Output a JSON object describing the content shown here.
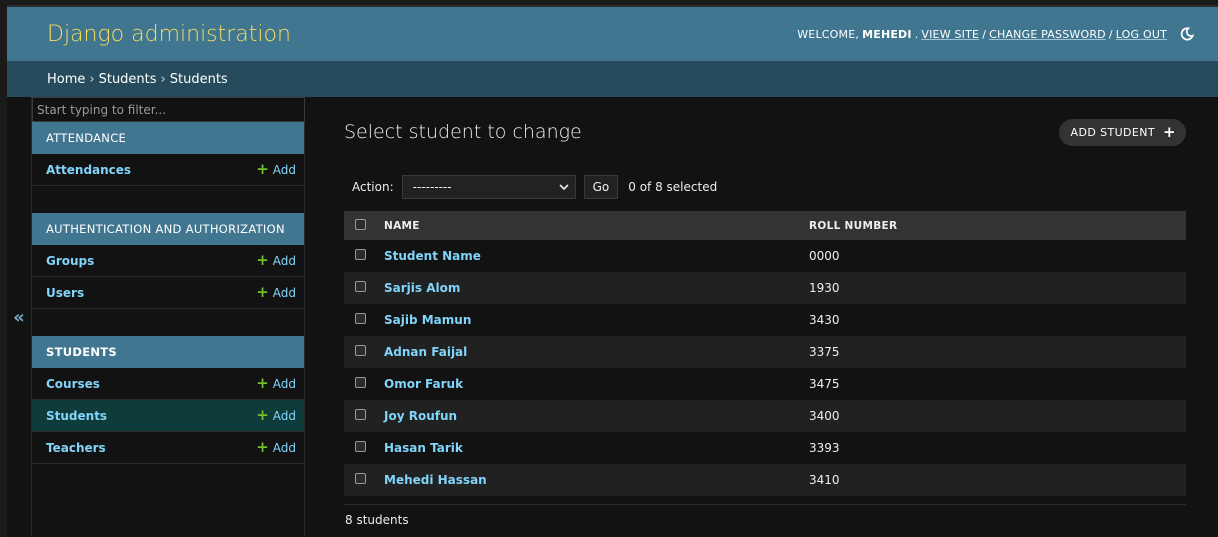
{
  "header": {
    "brand": "Django administration",
    "welcome": "WELCOME,",
    "username": "MEHEDI",
    "view_site": "VIEW SITE",
    "change_password": "CHANGE PASSWORD",
    "log_out": "LOG OUT",
    "separator": "/"
  },
  "breadcrumbs": [
    "Home",
    "Students",
    "Students"
  ],
  "nav_toggle": "«",
  "sidebar": {
    "filter_placeholder": "Start typing to filter...",
    "add_label": "Add",
    "modules": [
      {
        "caption": "ATTENDANCE",
        "models": [
          "Attendances"
        ]
      },
      {
        "caption": "AUTHENTICATION AND AUTHORIZATION",
        "models": [
          "Groups",
          "Users"
        ]
      },
      {
        "caption": "STUDENTS",
        "models": [
          "Courses",
          "Students",
          "Teachers"
        ],
        "current": "Students"
      }
    ]
  },
  "content": {
    "title": "Select student to change",
    "add_button": "ADD STUDENT",
    "action_label": "Action:",
    "action_selected": "---------",
    "go": "Go",
    "counter": "0 of 8 selected",
    "columns": [
      "NAME",
      "ROLL NUMBER"
    ],
    "rows": [
      {
        "name": "Student Name",
        "roll": "0000"
      },
      {
        "name": "Sarjis Alom",
        "roll": "1930"
      },
      {
        "name": "Sajib Mamun",
        "roll": "3430"
      },
      {
        "name": "Adnan Faijal",
        "roll": "3375"
      },
      {
        "name": "Omor Faruk",
        "roll": "3475"
      },
      {
        "name": "Joy Roufun",
        "roll": "3400"
      },
      {
        "name": "Hasan Tarik",
        "roll": "3393"
      },
      {
        "name": "Mehedi Hassan",
        "roll": "3410"
      }
    ],
    "paginator": "8 students"
  },
  "colors": {
    "header_bg": "#417690",
    "brand": "#f5dd5d",
    "breadcrumbs_bg": "#264b5d",
    "link": "#81d4fa",
    "add_plus": "#70bf2b",
    "current_row": "#0f3b3b"
  }
}
